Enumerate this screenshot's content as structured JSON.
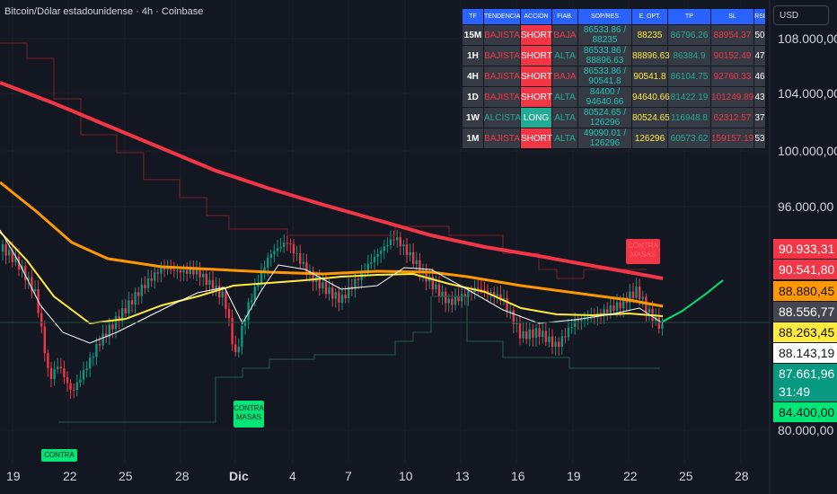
{
  "header": {
    "title": "Bitcoin/Dólar estadounidense · 4h · Coinbase",
    "currency": "USD"
  },
  "y_axis": {
    "labels": [
      "108.000,00",
      "104.000,00",
      "100.000,00",
      "96.000,00",
      "80.000,00"
    ]
  },
  "x_axis": {
    "labels": [
      "19",
      "22",
      "25",
      "28",
      "Dic",
      "4",
      "7",
      "10",
      "13",
      "16",
      "19",
      "22",
      "25",
      "28"
    ]
  },
  "price_labels": [
    {
      "text": "90.933,31",
      "bg": "#f23645",
      "fg": "#ffffff"
    },
    {
      "text": "90.541,80",
      "bg": "#f23645",
      "fg": "#ffffff"
    },
    {
      "text": "88.880,45",
      "bg": "#ff9800",
      "fg": "#131722"
    },
    {
      "text": "88.556,77",
      "bg": "#434651",
      "fg": "#ffffff"
    },
    {
      "text": "88.263,45",
      "bg": "#ffeb3b",
      "fg": "#131722"
    },
    {
      "text": "88.143,19",
      "bg": "#ffffff",
      "fg": "#131722"
    },
    {
      "text": "87.661,96",
      "bg": "#089981",
      "fg": "#ffffff"
    },
    {
      "text": "31:49",
      "bg": "#089981",
      "fg": "#ffffff"
    },
    {
      "text": "84.400,00",
      "bg": "#00e676",
      "fg": "#131722"
    }
  ],
  "annotations": {
    "contra_masas_1": "CONTRA MASAS",
    "contra_masas_2": "CONTRA MASAS",
    "contra": "CONTRA"
  },
  "table": {
    "headers": [
      "TF",
      "TENDENCIA",
      "ACCIÓN",
      "FIAB.",
      "SOP/RES",
      "E. OPT.",
      "TP",
      "SL",
      "RSI"
    ],
    "rows": [
      {
        "tf": "15M",
        "trend": "BAJISTA",
        "action": "SHORT",
        "fiab": "BAJA",
        "sopres": "86533.86 / 88235",
        "eopt": "88235",
        "tp": "86796.26",
        "sl": "88954.37",
        "rsi": "50"
      },
      {
        "tf": "1H",
        "trend": "BAJISTA",
        "action": "SHORT",
        "fiab": "ALTA",
        "sopres": "86533.86 / 88896.63",
        "eopt": "88896.63",
        "tp": "86384.9",
        "sl": "90152.49",
        "rsi": "47"
      },
      {
        "tf": "4H",
        "trend": "BAJISTA",
        "action": "SHORT",
        "fiab": "BAJA",
        "sopres": "86533.86 / 90541.8",
        "eopt": "90541.8",
        "tp": "86104.75",
        "sl": "92760.33",
        "rsi": "46"
      },
      {
        "tf": "1D",
        "trend": "BAJISTA",
        "action": "SHORT",
        "fiab": "ALTA",
        "sopres": "84400 / 94640.66",
        "eopt": "94640.66",
        "tp": "81422.19",
        "sl": "101249.89",
        "rsi": "43"
      },
      {
        "tf": "1W",
        "trend": "ALCISTA",
        "action": "LONG",
        "fiab": "ALTA",
        "sopres": "80524.65 / 126296",
        "eopt": "80524.65",
        "tp": "116948.8",
        "sl": "62312.57",
        "rsi": "37"
      },
      {
        "tf": "1M",
        "trend": "BAJISTA",
        "action": "SHORT",
        "fiab": "ALTA",
        "sopres": "49090.01 / 126296",
        "eopt": "126296",
        "tp": "60573.62",
        "sl": "159157.19",
        "rsi": "53"
      }
    ]
  },
  "colors": {
    "up": "#089981",
    "down": "#f23645",
    "ema_red": "#f23645",
    "ema_orange": "#ff9800",
    "ema_yellow": "#ffeb3b",
    "ema_white": "#ffffff",
    "projection": "#00e676"
  }
}
